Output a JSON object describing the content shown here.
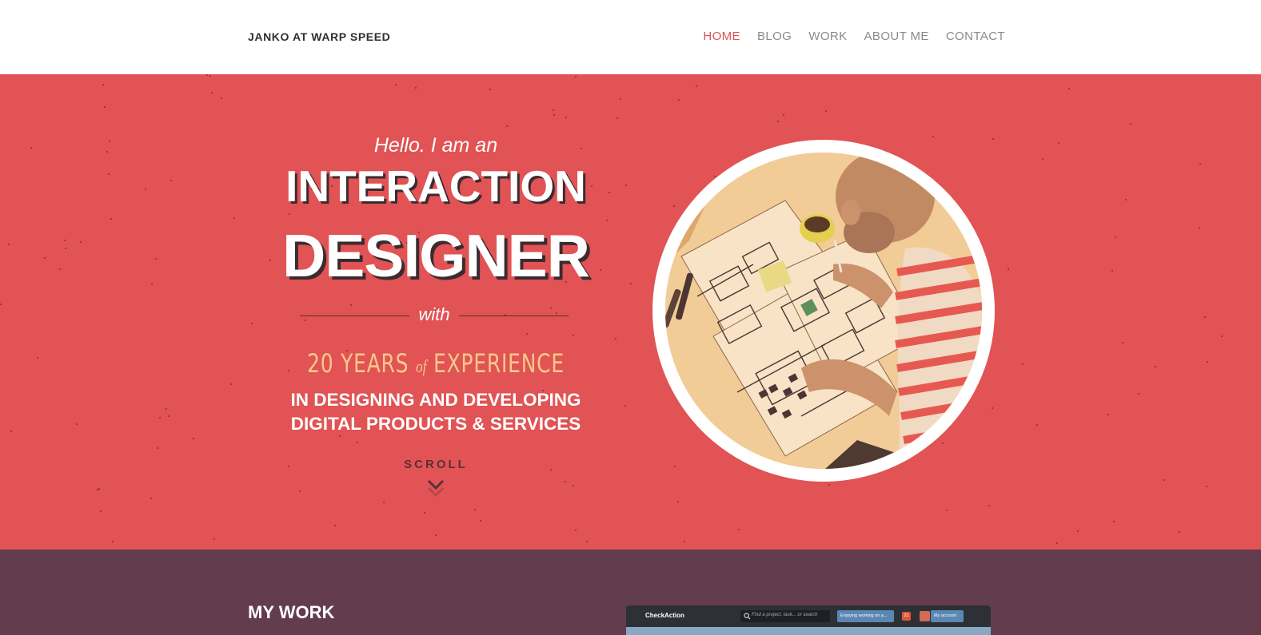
{
  "header": {
    "brand": "JANKO AT WARP SPEED",
    "nav": [
      {
        "label": "HOME",
        "active": true
      },
      {
        "label": "BLOG",
        "active": false
      },
      {
        "label": "WORK",
        "active": false
      },
      {
        "label": "ABOUT ME",
        "active": false
      },
      {
        "label": "CONTACT",
        "active": false
      }
    ]
  },
  "hero": {
    "greeting": "Hello. I am an",
    "title_line1": "INTERACTION",
    "title_line2": "DESIGNER",
    "connector": "with",
    "years_prefix": "20 YEARS",
    "years_of": "of",
    "years_suffix": "EXPERIENCE",
    "subtitle_line1": "IN DESIGNING AND DEVELOPING",
    "subtitle_line2": "DIGITAL PRODUCTS & SERVICES",
    "scroll_label": "SCROLL"
  },
  "work": {
    "title": "MY WORK",
    "preview": {
      "app_name": "CheckAction",
      "search_placeholder": "Find a project, task... or search",
      "status_select": "Enjoying working on a...",
      "badge_count": "21",
      "account_label": "My account"
    }
  },
  "colors": {
    "hero_bg": "#e15354",
    "work_bg": "#633c4e",
    "accent": "#e05255",
    "years_text": "#f7c88a"
  }
}
